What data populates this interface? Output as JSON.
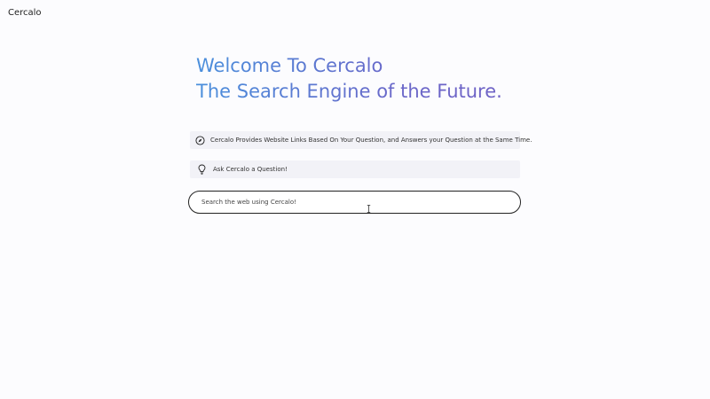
{
  "header": {
    "brand": "Cercalo"
  },
  "hero": {
    "line1": "Welcome To Cercalo",
    "line2": "The Search Engine of the Future."
  },
  "info": {
    "items": [
      {
        "icon": "compass-icon",
        "text": "Cercalo Provides Website Links Based On Your Question, and Answers your Question at the Same Time."
      },
      {
        "icon": "lightbulb-icon",
        "text": "Ask Cercalo a Question!"
      }
    ]
  },
  "search": {
    "placeholder": "Search the web using Cercalo!",
    "value": ""
  },
  "colors": {
    "gradient_start": "#4a8fdc",
    "gradient_end": "#6f5fc4",
    "info_bg": "#f2f2f7"
  }
}
